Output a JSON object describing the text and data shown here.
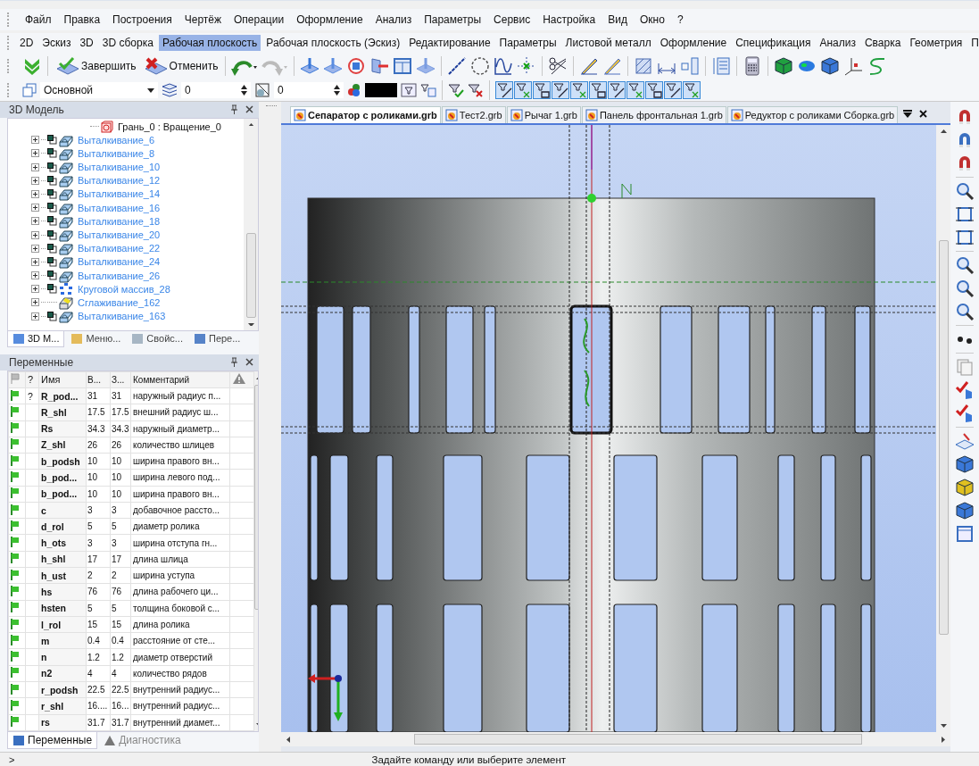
{
  "menu": [
    "Файл",
    "Правка",
    "Построения",
    "Чертёж",
    "Операции",
    "Оформление",
    "Анализ",
    "Параметры",
    "Сервис",
    "Настройка",
    "Вид",
    "Окно",
    "?"
  ],
  "ribbon_tabs": [
    {
      "label": "2D",
      "selected": false
    },
    {
      "label": "Эскиз",
      "selected": false
    },
    {
      "label": "3D",
      "selected": false
    },
    {
      "label": "3D сборка",
      "selected": false
    },
    {
      "label": "Рабочая плоскость",
      "selected": true
    },
    {
      "label": "Рабочая плоскость (Эскиз)",
      "selected": false
    },
    {
      "label": "Редактирование",
      "selected": false
    },
    {
      "label": "Параметры",
      "selected": false
    },
    {
      "label": "Листовой металл",
      "selected": false
    },
    {
      "label": "Оформление",
      "selected": false
    },
    {
      "label": "Спецификация",
      "selected": false
    },
    {
      "label": "Анализ",
      "selected": false
    },
    {
      "label": "Сварка",
      "selected": false
    },
    {
      "label": "Геометрия",
      "selected": false
    },
    {
      "label": "П",
      "selected": false
    }
  ],
  "toolbar": {
    "finish_label": "Завершить",
    "cancel_label": "Отменить"
  },
  "properties_bar": {
    "style": "Основной",
    "layer": "0",
    "level": "0"
  },
  "model_panel": {
    "title": "3D Модель",
    "items": [
      {
        "label": "Грань_0 : Вращение_0",
        "kind": "face"
      },
      {
        "label": "Выталкивание_6",
        "kind": "extrude"
      },
      {
        "label": "Выталкивание_8",
        "kind": "extrude"
      },
      {
        "label": "Выталкивание_10",
        "kind": "extrude"
      },
      {
        "label": "Выталкивание_12",
        "kind": "extrude"
      },
      {
        "label": "Выталкивание_14",
        "kind": "extrude"
      },
      {
        "label": "Выталкивание_16",
        "kind": "extrude"
      },
      {
        "label": "Выталкивание_18",
        "kind": "extrude"
      },
      {
        "label": "Выталкивание_20",
        "kind": "extrude"
      },
      {
        "label": "Выталкивание_22",
        "kind": "extrude"
      },
      {
        "label": "Выталкивание_24",
        "kind": "extrude"
      },
      {
        "label": "Выталкивание_26",
        "kind": "extrude"
      },
      {
        "label": "Круговой массив_28",
        "kind": "pattern"
      },
      {
        "label": "Сглаживание_162",
        "kind": "fillet"
      },
      {
        "label": "Выталкивание_163",
        "kind": "extrude"
      }
    ],
    "tabs": [
      {
        "label": "3D М...",
        "selected": true
      },
      {
        "label": "Меню...",
        "selected": false
      },
      {
        "label": "Свойс...",
        "selected": false
      },
      {
        "label": "Пере...",
        "selected": false
      }
    ]
  },
  "variables_panel": {
    "title": "Переменные",
    "columns": [
      "?",
      "Имя",
      "В...",
      "З...",
      "Комментарий"
    ],
    "rows": [
      {
        "question": "?",
        "name": "R_pod...",
        "value": "31",
        "expression": "31",
        "comment": "наружный радиус п..."
      },
      {
        "name": "R_shl",
        "value": "17.5",
        "expression": "17.5",
        "comment": "внешний радиус ш..."
      },
      {
        "name": "Rs",
        "value": "34.3",
        "expression": "34.3",
        "comment": "наружный диаметр..."
      },
      {
        "name": "Z_shl",
        "value": "26",
        "expression": "26",
        "comment": "количество шлицев"
      },
      {
        "name": "b_podsh",
        "value": "10",
        "expression": "10",
        "comment": "ширина правого вн..."
      },
      {
        "name": "b_pod...",
        "value": "10",
        "expression": "10",
        "comment": "ширина левого под..."
      },
      {
        "name": "b_pod...",
        "value": "10",
        "expression": "10",
        "comment": "ширина правого вн..."
      },
      {
        "name": "c",
        "value": "3",
        "expression": "3",
        "comment": "добавочное рассто..."
      },
      {
        "name": "d_rol",
        "value": "5",
        "expression": "5",
        "comment": "диаметр ролика"
      },
      {
        "name": "h_ots",
        "value": "3",
        "expression": "3",
        "comment": "ширина отступа гн..."
      },
      {
        "name": "h_shl",
        "value": "17",
        "expression": "17",
        "comment": "длина шлица"
      },
      {
        "name": "h_ust",
        "value": "2",
        "expression": "2",
        "comment": "ширина уступа"
      },
      {
        "name": "hs",
        "value": "76",
        "expression": "76",
        "comment": "длина рабочего ци..."
      },
      {
        "name": "hsten",
        "value": "5",
        "expression": "5",
        "comment": "толщина боковой с..."
      },
      {
        "name": "l_rol",
        "value": "15",
        "expression": "15",
        "comment": "длина ролика"
      },
      {
        "name": "m",
        "value": "0.4",
        "expression": "0.4",
        "comment": "расстояние от сте..."
      },
      {
        "name": "n",
        "value": "1.2",
        "expression": "1.2",
        "comment": "диаметр отверстий"
      },
      {
        "name": "n2",
        "value": "4",
        "expression": "4",
        "comment": "количество рядов"
      },
      {
        "name": "r_podsh",
        "value": "22.5",
        "expression": "22.5",
        "comment": "внутренний радиус..."
      },
      {
        "name": "r_shl",
        "value": "16....",
        "expression": "16...",
        "comment": "внутренний радиус..."
      },
      {
        "name": "rs",
        "value": "31.7",
        "expression": "31.7",
        "comment": "внутренний диамет..."
      }
    ],
    "tabs": [
      {
        "label": "Переменные",
        "selected": true
      },
      {
        "label": "Диагностика",
        "selected": false
      }
    ]
  },
  "document_tabs": [
    {
      "label": "Сепаратор с роликами.grb",
      "selected": true
    },
    {
      "label": "Тест2.grb",
      "selected": false
    },
    {
      "label": "Рычаг 1.grb",
      "selected": false
    },
    {
      "label": "Панель фронтальная 1.grb",
      "selected": false
    },
    {
      "label": "Редуктор с роликами Сборка.grb",
      "selected": false
    }
  ],
  "status_bar": {
    "prompt": ">",
    "message": "Задайте команду или выберите элемент"
  }
}
